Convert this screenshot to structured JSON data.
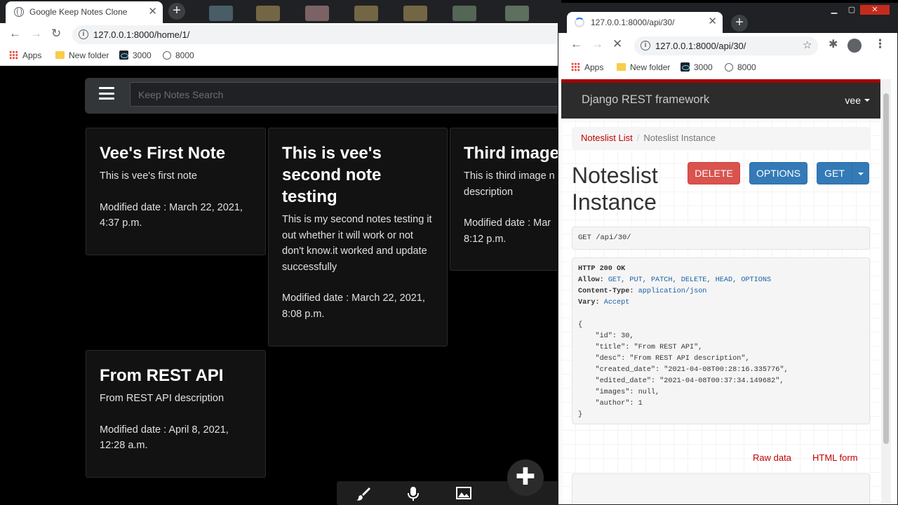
{
  "left_browser": {
    "tab_title": "Google Keep Notes Clone",
    "url": "127.0.0.1:8000/home/1/",
    "bookmarks": [
      "Apps",
      "New folder",
      "3000",
      "8000"
    ]
  },
  "keep_app": {
    "search_placeholder": "Keep Notes Search",
    "notes": [
      {
        "title": "Vee's First Note",
        "desc": "This is vee's first note",
        "modified": "Modified date : March 22, 2021, 4:37 p.m."
      },
      {
        "title": "This is vee's second note testing",
        "desc": "This is my second notes testing it out whether it will work or not don't know.it worked and update successfully",
        "modified": "Modified date : March 22, 2021, 8:08 p.m."
      },
      {
        "title": "Third image",
        "desc": "This is third image n description",
        "modified": "Modified date : Mar 8:12 p.m."
      },
      {
        "title": "From REST API",
        "desc": "From REST API description",
        "modified": "Modified date : April 8, 2021, 12:28 a.m."
      }
    ],
    "fab_symbol": "✚",
    "bottom_icons": [
      "brush-icon",
      "microphone-icon",
      "image-icon"
    ]
  },
  "right_browser": {
    "tab_title": "127.0.0.1:8000/api/30/",
    "url": "127.0.0.1:8000/api/30/",
    "bookmarks": [
      "Apps",
      "New folder",
      "3000",
      "8000"
    ]
  },
  "drf": {
    "brand": "Django REST framework",
    "user": "vee",
    "breadcrumb_link": "Noteslist List",
    "breadcrumb_active": "Noteslist Instance",
    "title_line1": "Noteslist",
    "title_line2": "Instance",
    "btn_delete": "DELETE",
    "btn_options": "OPTIONS",
    "btn_get": "GET",
    "request_line": "GET /api/30/",
    "status_line": "HTTP 200 OK",
    "allow_label": "Allow:",
    "allow_value": "GET, PUT, PATCH, DELETE, HEAD, OPTIONS",
    "ctype_label": "Content-Type:",
    "ctype_value": "application/json",
    "vary_label": "Vary:",
    "vary_value": "Accept",
    "json_body": "{\n    \"id\": 30,\n    \"title\": \"From REST API\",\n    \"desc\": \"From REST API description\",\n    \"created_date\": \"2021-04-08T00:28:16.335776\",\n    \"edited_date\": \"2021-04-08T00:37:34.149682\",\n    \"images\": null,\n    \"author\": 1\n}",
    "raw_data": "Raw data",
    "html_form": "HTML form"
  },
  "colors": {
    "drf_red": "#a30000",
    "delete_btn": "#d9534f",
    "primary_btn": "#337ab7",
    "note_bg": "#121212"
  }
}
